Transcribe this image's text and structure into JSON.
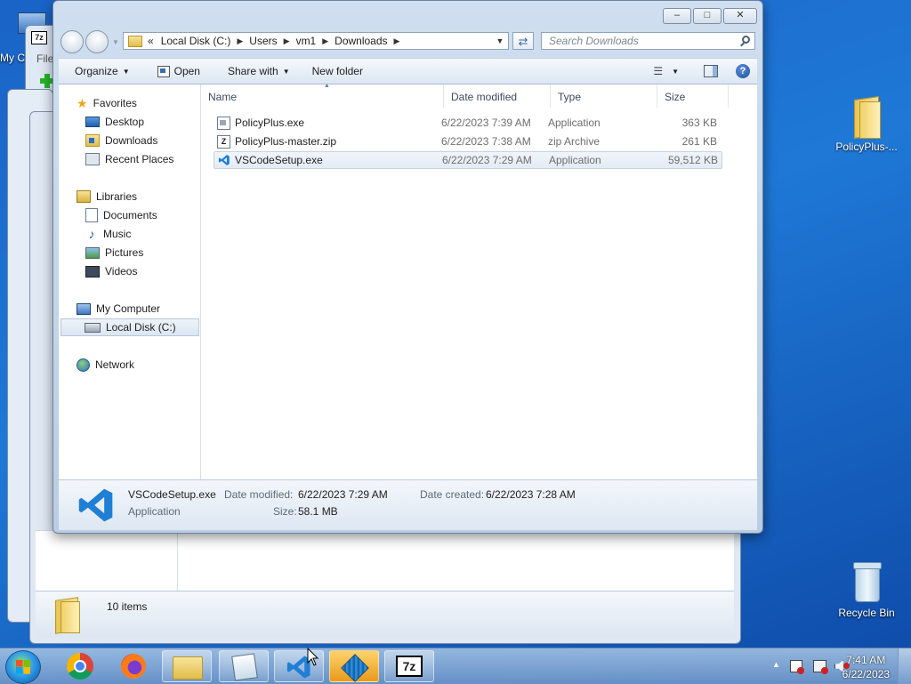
{
  "desktop": {
    "my_computer_label": "My C",
    "policyplus_folder_label": "PolicyPlus-...",
    "recycle_bin_label": "Recycle Bin"
  },
  "background_windows": {
    "sevenzip_title_glyph": "7z",
    "menu_file": "File",
    "add_label": "Ad",
    "status_items": "10 items"
  },
  "window": {
    "address": {
      "overflow": "«",
      "crumbs": [
        "Local Disk (C:)",
        "Users",
        "vm1",
        "Downloads"
      ]
    },
    "search_placeholder": "Search Downloads",
    "toolbar": {
      "organize": "Organize",
      "open": "Open",
      "share_with": "Share with",
      "new_folder": "New folder"
    },
    "nav": {
      "favorites": "Favorites",
      "desktop": "Desktop",
      "downloads": "Downloads",
      "recent_places": "Recent Places",
      "libraries": "Libraries",
      "documents": "Documents",
      "music": "Music",
      "pictures": "Pictures",
      "videos": "Videos",
      "my_computer": "My Computer",
      "local_disk": "Local Disk (C:)",
      "network": "Network"
    },
    "columns": {
      "name": "Name",
      "date_modified": "Date modified",
      "type": "Type",
      "size": "Size"
    },
    "files": [
      {
        "name": "PolicyPlus.exe",
        "date": "6/22/2023 7:39 AM",
        "type": "Application",
        "size": "363 KB"
      },
      {
        "name": "PolicyPlus-master.zip",
        "date": "6/22/2023 7:38 AM",
        "type": "zip Archive",
        "size": "261 KB"
      },
      {
        "name": "VSCodeSetup.exe",
        "date": "6/22/2023 7:29 AM",
        "type": "Application",
        "size": "59,512 KB"
      }
    ],
    "details": {
      "name": "VSCodeSetup.exe",
      "type": "Application",
      "date_modified_label": "Date modified:",
      "date_modified": "6/22/2023 7:29 AM",
      "date_created_label": "Date created:",
      "date_created": "6/22/2023 7:28 AM",
      "size_label": "Size:",
      "size": "58.1 MB"
    }
  },
  "taskbar": {
    "sevenzip_label": "7z",
    "time": "7:41 AM",
    "date": "6/22/2023"
  },
  "colors": {
    "vscode_blue": "#1f7fd4",
    "desktop_blue": "#1f78d6",
    "folder_yellow": "#f2d56b"
  }
}
